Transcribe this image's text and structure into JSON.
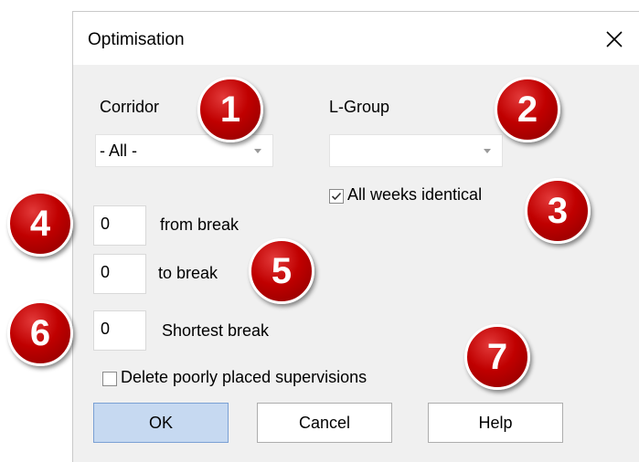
{
  "dialog": {
    "title": "Optimisation",
    "close_icon": "close-icon"
  },
  "corridor": {
    "label": "Corridor",
    "value": "- All -"
  },
  "lgroup": {
    "label": "L-Group",
    "value": ""
  },
  "all_weeks": {
    "label": "All weeks identical",
    "checked": true
  },
  "from_break": {
    "value": "0",
    "label": "from break"
  },
  "to_break": {
    "value": "0",
    "label": "to break"
  },
  "shortest_break": {
    "value": "0",
    "label": "Shortest break"
  },
  "delete_poor": {
    "label": "Delete poorly placed supervisions",
    "checked": false
  },
  "buttons": {
    "ok": "OK",
    "cancel": "Cancel",
    "help": "Help"
  },
  "callouts": [
    "1",
    "2",
    "3",
    "4",
    "5",
    "6",
    "7"
  ],
  "colors": {
    "callout": "#c00000",
    "ok_button": "#c6d9f1",
    "dialog_bg": "#f0f0f0"
  }
}
